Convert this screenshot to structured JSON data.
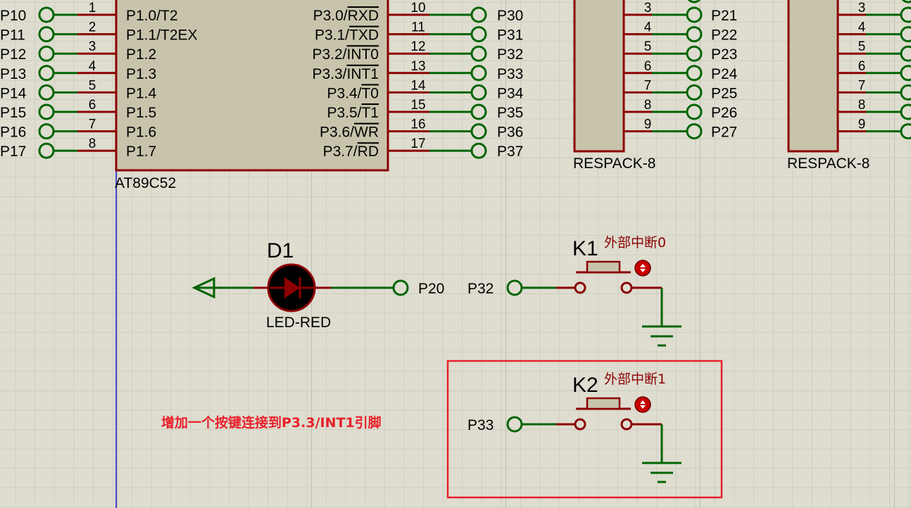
{
  "mcu": {
    "name": "AT89C52",
    "left_pins": [
      {
        "num": "1",
        "name": "P1.0/T2",
        "terminal": "P10"
      },
      {
        "num": "2",
        "name": "P1.1/T2EX",
        "terminal": "P11"
      },
      {
        "num": "3",
        "name": "P1.2",
        "terminal": "P12"
      },
      {
        "num": "4",
        "name": "P1.3",
        "terminal": "P13"
      },
      {
        "num": "5",
        "name": "P1.4",
        "terminal": "P14"
      },
      {
        "num": "6",
        "name": "P1.5",
        "terminal": "P15"
      },
      {
        "num": "7",
        "name": "P1.6",
        "terminal": "P16"
      },
      {
        "num": "8",
        "name": "P1.7",
        "terminal": "P17"
      }
    ],
    "right_pins": [
      {
        "num": "10",
        "prefix": "P3.0/",
        "suffix": "RXD",
        "overline": false,
        "terminal": "P30"
      },
      {
        "num": "11",
        "prefix": "P3.1/",
        "suffix": "TXD",
        "overline": false,
        "terminal": "P31"
      },
      {
        "num": "12",
        "prefix": "P3.2/",
        "suffix": "INT0",
        "overline": true,
        "terminal": "P32"
      },
      {
        "num": "13",
        "prefix": "P3.3/",
        "suffix": "INT1",
        "overline": true,
        "terminal": "P33"
      },
      {
        "num": "14",
        "prefix": "P3.4/",
        "suffix": "T0",
        "overline": false,
        "terminal": "P34"
      },
      {
        "num": "15",
        "prefix": "P3.5/",
        "suffix": "T1",
        "overline": false,
        "terminal": "P35"
      },
      {
        "num": "16",
        "prefix": "P3.6/",
        "suffix": "WR",
        "overline": true,
        "terminal": "P36"
      },
      {
        "num": "17",
        "prefix": "P3.7/",
        "suffix": "RD",
        "overline": true,
        "terminal": "P37"
      }
    ]
  },
  "respacks": [
    {
      "label": "RESPACK-8",
      "pins": [
        "3",
        "4",
        "5",
        "6",
        "7",
        "8",
        "9"
      ],
      "terminals": [
        "P21",
        "P22",
        "P23",
        "P24",
        "P25",
        "P26",
        "P27"
      ]
    },
    {
      "label": "RESPACK-8",
      "pins": [
        "3",
        "4",
        "5",
        "6",
        "7",
        "8",
        "9"
      ],
      "terminals": []
    }
  ],
  "led": {
    "ref": "D1",
    "value": "LED-RED",
    "terminal": "P20"
  },
  "switches": [
    {
      "ref": "K1",
      "label": "外部中断0",
      "terminal": "P32"
    },
    {
      "ref": "K2",
      "label": "外部中断1",
      "terminal": "P33"
    }
  ],
  "annotation": "增加一个按键连接到P3.3/INT1引脚",
  "colors": {
    "wire": "#006400",
    "part": "#8b0000",
    "body": "#c8c4ac",
    "highlight": "#e8202a",
    "cursor_line": "#1a1acd",
    "background": "#deddd0"
  }
}
